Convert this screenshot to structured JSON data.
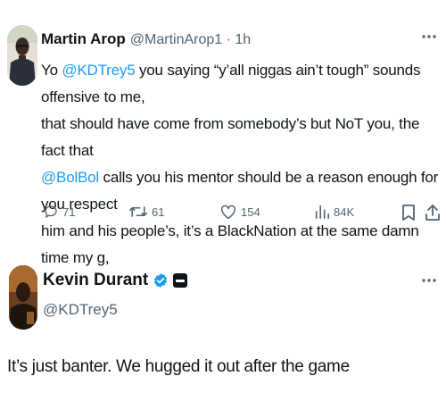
{
  "tweet1": {
    "author_name": "Martin Arop",
    "handle_time": "@MartinArop1 · 1h",
    "lines": [
      {
        "pre": "Yo ",
        "mention": "@KDTrey5",
        "post": " you saying “y’all niggas ain’t tough” sounds offensive to me,"
      },
      {
        "pre": "that should have come from somebody’s but NoT you, the fact that",
        "mention": "",
        "post": ""
      },
      {
        "pre": "",
        "mention": "@BolBol",
        "post": " calls you his mentor should be a reason enough for you respect"
      },
      {
        "pre": "him and his people’s, it’s a BlackNation at the same damn time my g,",
        "mention": "",
        "post": ""
      }
    ],
    "stats": {
      "replies": "71",
      "retweets": "61",
      "likes": "154",
      "views": "84K"
    }
  },
  "tweet2": {
    "author_name": "Kevin Durant",
    "handle": "@KDTrey5",
    "text": "It’s just banter. We hugged it out after the game"
  },
  "icons": {
    "reply": "comment-icon",
    "retweet": "retweet-icon",
    "like": "heart-icon",
    "views": "views-chart-icon",
    "bookmark": "bookmark-icon",
    "share": "share-icon",
    "verified": "verified-badge-icon",
    "more": "more-dots-icon"
  },
  "colors": {
    "text": "#0f1419",
    "muted": "#536471",
    "link": "#1d9bf0",
    "verified": "#1d9bf0"
  }
}
